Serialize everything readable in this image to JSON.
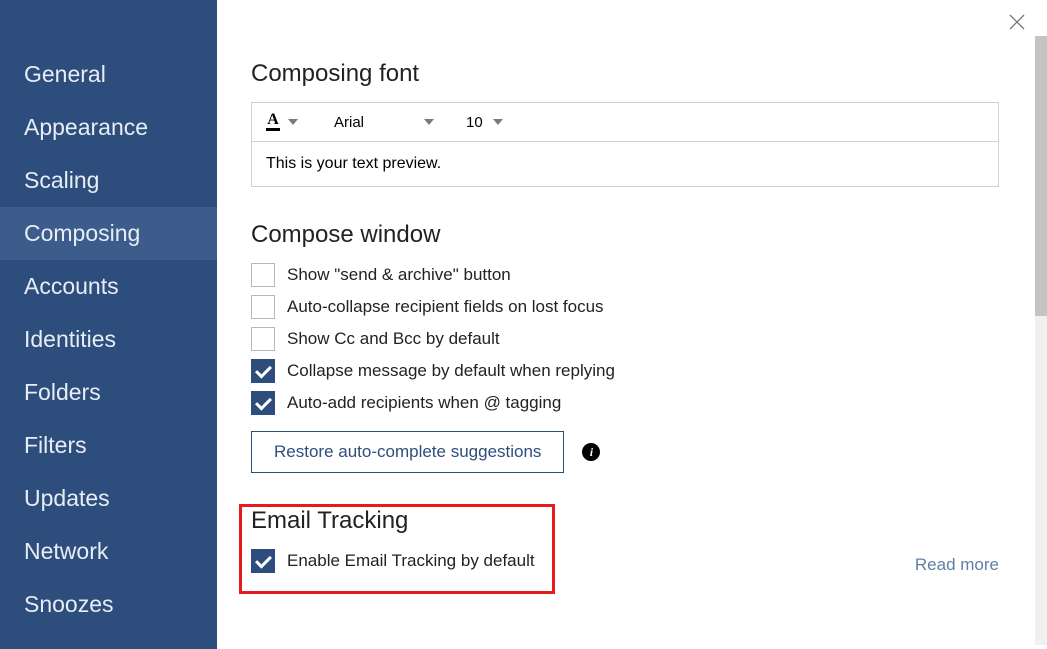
{
  "sidebar": {
    "items": [
      {
        "label": "General"
      },
      {
        "label": "Appearance"
      },
      {
        "label": "Scaling"
      },
      {
        "label": "Composing",
        "active": true
      },
      {
        "label": "Accounts"
      },
      {
        "label": "Identities"
      },
      {
        "label": "Folders"
      },
      {
        "label": "Filters"
      },
      {
        "label": "Updates"
      },
      {
        "label": "Network"
      },
      {
        "label": "Snoozes"
      }
    ]
  },
  "sections": {
    "composing_font": {
      "title": "Composing font",
      "font_family": "Arial",
      "font_size": "10",
      "preview": "This is your text preview."
    },
    "compose_window": {
      "title": "Compose window",
      "options": [
        {
          "label": "Show \"send & archive\" button",
          "checked": false
        },
        {
          "label": "Auto-collapse recipient fields on lost focus",
          "checked": false
        },
        {
          "label": "Show Cc and Bcc by default",
          "checked": false
        },
        {
          "label": "Collapse message by default when replying",
          "checked": true
        },
        {
          "label": "Auto-add recipients when @ tagging",
          "checked": true
        }
      ],
      "restore_button": "Restore auto-complete suggestions"
    },
    "email_tracking": {
      "title": "Email Tracking",
      "option_label": "Enable Email Tracking by default",
      "option_checked": true,
      "read_more": "Read more"
    }
  }
}
